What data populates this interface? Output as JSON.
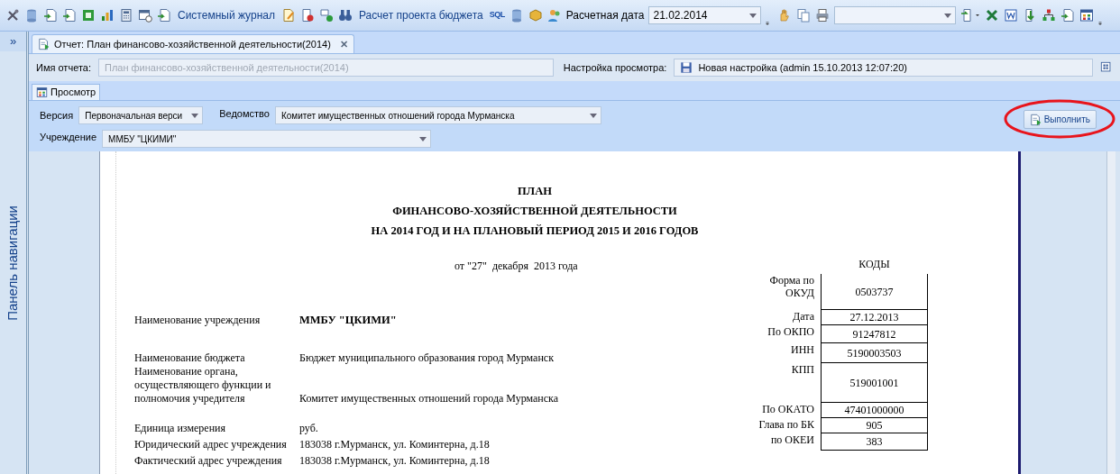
{
  "toolbar": [
    {
      "kind": "icon"
    },
    {
      "kind": "icon"
    },
    {
      "kind": "icon"
    },
    {
      "kind": "icon"
    },
    {
      "kind": "icon"
    },
    {
      "kind": "icon"
    },
    {
      "kind": "icon"
    },
    {
      "kind": "icon"
    },
    {
      "kind": "icon"
    },
    {
      "kind": "button",
      "label": "Системный журнал"
    },
    {
      "kind": "icon"
    },
    {
      "kind": "icon"
    },
    {
      "kind": "icon"
    },
    {
      "kind": "icon"
    },
    {
      "kind": "button",
      "label": "Расчет проекта бюджета"
    },
    {
      "kind": "glyph",
      "text": "SQL"
    },
    {
      "kind": "icon"
    },
    {
      "kind": "icon"
    },
    {
      "kind": "icon"
    },
    {
      "kind": "label",
      "text": "Расчетная дата"
    },
    {
      "kind": "combo",
      "value": "21.02.2014"
    },
    {
      "kind": "grip"
    },
    {
      "kind": "icon"
    },
    {
      "kind": "icon"
    },
    {
      "kind": "icon"
    },
    {
      "kind": "combo"
    },
    {
      "kind": "icon"
    },
    {
      "kind": "icon"
    },
    {
      "kind": "icon"
    },
    {
      "kind": "icon"
    },
    {
      "kind": "icon"
    },
    {
      "kind": "icon"
    },
    {
      "kind": "icon"
    },
    {
      "kind": "grip"
    }
  ],
  "navigation": {
    "collapse_glyph": "»",
    "title": "Панель навигации"
  },
  "document_tab": {
    "title": "Отчет: План финансово-хозяйственной деятельности(2014)",
    "close_glyph": "✕"
  },
  "report_name": {
    "label": "Имя отчета:",
    "value": "План финансово-хозяйственной деятельности(2014)",
    "disabled": true
  },
  "view_setting": {
    "label": "Настройка просмотра:",
    "value": "Новая настройка (admin 15.10.2013 12:07:20)"
  },
  "subtabs": [
    {
      "label": "Просмотр",
      "selected": true
    }
  ],
  "params": [
    {
      "label": "Версия",
      "value": "Первоначальная верси"
    },
    {
      "label": "Ведомство",
      "value": "Комитет имущественных отношений города Мурманска"
    },
    {
      "label": "Учреждение",
      "value": "ММБУ \"ЦКИМИ\""
    }
  ],
  "run_button": {
    "label": "Выполнить",
    "highlighted": true
  },
  "report": {
    "title_lines": [
      "ПЛАН",
      "ФИНАНСОВО-ХОЗЯЙСТВЕННОЙ ДЕЯТЕЛЬНОСТИ",
      "НА 2014 ГОД И НА ПЛАНОВЫЙ ПЕРИОД 2015 И 2016 ГОДОВ"
    ],
    "date_line": "от \"27\"  декабря  2013 года",
    "fields": [
      {
        "label": "Наименование учреждения",
        "value": "ММБУ \"ЦКИМИ\""
      },
      {
        "label": "Наименование бюджета",
        "value": "Бюджет муниципального образования город Мурманск"
      },
      {
        "label": "Наименование органа, осуществляющего функции и полномочия учредителя",
        "value": "Комитет имущественных отношений города Мурманска"
      },
      {
        "label": "Единица измерения",
        "value": "руб."
      },
      {
        "label": "Юридический адрес учреждения",
        "value": "183038 г.Мурманск, ул. Коминтерна, д.18"
      },
      {
        "label": "Фактический адрес учреждения",
        "value": "183038 г.Мурманск, ул. Коминтерна, д.18"
      }
    ],
    "codes_title": "КОДЫ",
    "codes": [
      {
        "label": "Форма по ОКУД",
        "value": "0503737"
      },
      {
        "label": "Дата",
        "value": "27.12.2013"
      },
      {
        "label": "По ОКПО",
        "value": "91247812"
      },
      {
        "label": "ИНН",
        "value": "5190003503"
      },
      {
        "label": "КПП",
        "value": "519001001"
      },
      {
        "label": "По ОКАТО",
        "value": "47401000000"
      },
      {
        "label": "Глава по БК",
        "value": "905"
      },
      {
        "label": "по ОКЕИ",
        "value": "383"
      }
    ]
  }
}
